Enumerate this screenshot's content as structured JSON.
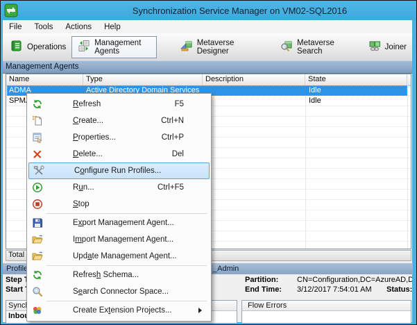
{
  "window": {
    "title": "Synchronization Service Manager on VM02-SQL2016",
    "app_icon": "sync-app-icon"
  },
  "menubar": {
    "items": [
      {
        "label": "File"
      },
      {
        "label": "Tools"
      },
      {
        "label": "Actions"
      },
      {
        "label": "Help"
      }
    ]
  },
  "toolbar": {
    "buttons": [
      {
        "label": "Operations",
        "icon": "operations-icon",
        "active": false
      },
      {
        "label": "Management Agents",
        "icon": "management-agents-icon",
        "active": true
      },
      {
        "label": "Metaverse Designer",
        "icon": "metaverse-designer-icon",
        "active": false
      },
      {
        "label": "Metaverse Search",
        "icon": "metaverse-search-icon",
        "active": false
      },
      {
        "label": "Joiner",
        "icon": "joiner-icon",
        "active": false
      }
    ]
  },
  "section": {
    "title": "Management Agents"
  },
  "ma_list": {
    "columns": [
      {
        "label": "Name"
      },
      {
        "label": "Type"
      },
      {
        "label": "Description"
      },
      {
        "label": "State"
      }
    ],
    "rows": [
      {
        "name": "ADMA",
        "type": "Active Directory Domain Services",
        "description": "",
        "state": "Idle",
        "selected": true
      },
      {
        "name": "SPMA",
        "type": "",
        "description": "",
        "state": "Idle",
        "selected": false
      }
    ]
  },
  "context_menu": {
    "items": [
      {
        "pre": "",
        "accel": "R",
        "post": "efresh",
        "shortcut": "F5",
        "icon": "refresh-icon",
        "highlighted": false
      },
      {
        "pre": "",
        "accel": "C",
        "post": "reate...",
        "shortcut": "Ctrl+N",
        "icon": "create-icon",
        "highlighted": false
      },
      {
        "pre": "",
        "accel": "P",
        "post": "roperties...",
        "shortcut": "Ctrl+P",
        "icon": "properties-icon",
        "highlighted": false
      },
      {
        "pre": "",
        "accel": "D",
        "post": "elete...",
        "shortcut": "Del",
        "icon": "delete-icon",
        "highlighted": false
      },
      {
        "pre": "C",
        "accel": "o",
        "post": "nfigure Run Profiles...",
        "shortcut": "",
        "icon": "configure-run-profiles-icon",
        "highlighted": true
      },
      {
        "pre": "R",
        "accel": "u",
        "post": "n...",
        "shortcut": "Ctrl+F5",
        "icon": "run-icon",
        "highlighted": false
      },
      {
        "pre": "",
        "accel": "S",
        "post": "top",
        "shortcut": "",
        "icon": "stop-icon",
        "highlighted": false
      },
      {
        "pre": "E",
        "accel": "x",
        "post": "port Management Agent...",
        "shortcut": "",
        "icon": "export-ma-icon",
        "highlighted": false
      },
      {
        "pre": "I",
        "accel": "m",
        "post": "port Management Agent...",
        "shortcut": "",
        "icon": "import-ma-icon",
        "highlighted": false
      },
      {
        "pre": "Upd",
        "accel": "a",
        "post": "te Management Agent...",
        "shortcut": "",
        "icon": "update-ma-icon",
        "highlighted": false
      },
      {
        "pre": "Refres",
        "accel": "h",
        "post": " Schema...",
        "shortcut": "",
        "icon": "refresh-schema-icon",
        "highlighted": false
      },
      {
        "pre": "S",
        "accel": "e",
        "post": "arch Connector Space...",
        "shortcut": "",
        "icon": "search-connector-icon",
        "highlighted": false
      },
      {
        "pre": "Create Ex",
        "accel": "t",
        "post": "ension Projects...",
        "shortcut": "",
        "icon": "extension-projects-icon",
        "highlighted": false,
        "has_submenu": true
      }
    ]
  },
  "status_bar": {
    "text_fragment": "Total n"
  },
  "run_details": {
    "profile_label_fragment": "Profile ",
    "profile_value_fragment": "_Admin",
    "step_label_fragment": "Step T",
    "start_label_fragment": "Start T",
    "partition_label": "Partition:",
    "partition_value": "CN=Configuration,DC=AzureAD,DC=",
    "end_time_label": "End Time:",
    "end_time_value": "3/12/2017 7:54:01 AM",
    "status_label": "Status:"
  },
  "bottom_panels": {
    "left_header_fragment": "Synch",
    "left_row_fragment": "Inbou",
    "right_header": "Flow Errors"
  },
  "colors": {
    "titlebar_blue": "#45B1E2",
    "section_band": "#8CA6C3",
    "selection_blue": "#2D94E5",
    "selection_focus_dotted": "#E09B54",
    "menu_highlight_bg": "#D4EAFF",
    "menu_highlight_border": "#5E9FD6"
  }
}
